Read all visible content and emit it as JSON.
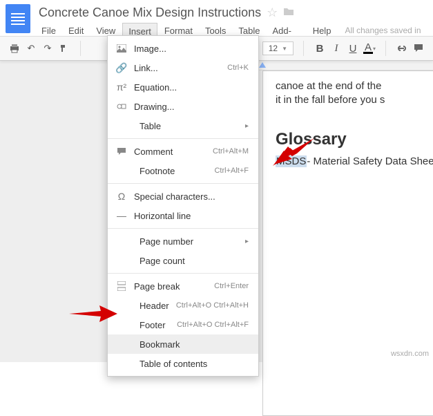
{
  "doc": {
    "title": "Concrete Canoe Mix Design Instructions"
  },
  "menubar": {
    "file": "File",
    "edit": "Edit",
    "view": "View",
    "insert": "Insert",
    "format": "Format",
    "tools": "Tools",
    "table": "Table",
    "addons": "Add-ons",
    "help": "Help",
    "saved": "All changes saved in Drive"
  },
  "toolbar": {
    "font_size": "12"
  },
  "dropdown": {
    "image": "Image...",
    "link": "Link...",
    "link_sc": "Ctrl+K",
    "equation": "Equation...",
    "drawing": "Drawing...",
    "table": "Table",
    "comment": "Comment",
    "comment_sc": "Ctrl+Alt+M",
    "footnote": "Footnote",
    "footnote_sc": "Ctrl+Alt+F",
    "special": "Special characters...",
    "hline": "Horizontal line",
    "pagenum": "Page number",
    "pagecount": "Page count",
    "pagebreak": "Page break",
    "pagebreak_sc": "Ctrl+Enter",
    "header": "Header",
    "header_sc": "Ctrl+Alt+O Ctrl+Alt+H",
    "footer": "Footer",
    "footer_sc": "Ctrl+Alt+O Ctrl+Alt+F",
    "bookmark": "Bookmark",
    "toc": "Table of contents"
  },
  "page": {
    "line1": "canoe at the end of the",
    "line2": "it in the fall before you s",
    "glossary_heading": "Glossary",
    "msds": "MSDS",
    "msds_rest": "- Material Safety Data Sheets"
  },
  "watermark": "wsxdn.com"
}
